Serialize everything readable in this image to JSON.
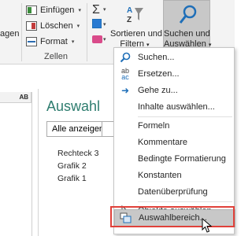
{
  "ribbon": {
    "left_fragment": "agen",
    "cells_group": {
      "insert_label": "Einfügen",
      "delete_label": "Löschen",
      "format_label": "Format",
      "group_label": "Zellen"
    },
    "editing_group": {
      "sort_filter_line1": "Sortieren und",
      "sort_filter_line2": "Filtern",
      "find_select_line1": "Suchen und",
      "find_select_line2": "Auswählen"
    }
  },
  "grid": {
    "column_header": "AB"
  },
  "selection_pane": {
    "title": "Auswahl",
    "show_all_label": "Alle anzeigen",
    "items": [
      {
        "label": "Rechteck 3"
      },
      {
        "label": "Grafik 2"
      },
      {
        "label": "Grafik 1"
      }
    ]
  },
  "menu": {
    "items": [
      {
        "label": "Suchen...",
        "icon": "magnifier-icon"
      },
      {
        "label": "Ersetzen...",
        "icon": "replace-icon"
      },
      {
        "label": "Gehe zu...",
        "icon": "arrow-right-icon"
      },
      {
        "label": "Inhalte auswählen...",
        "icon": ""
      },
      {
        "label": "Formeln",
        "icon": ""
      },
      {
        "label": "Kommentare",
        "icon": ""
      },
      {
        "label": "Bedingte Formatierung",
        "icon": ""
      },
      {
        "label": "Konstanten",
        "icon": ""
      },
      {
        "label": "Datenüberprüfung",
        "icon": ""
      },
      {
        "label": "Objekte auswählen",
        "icon": "pointer-arrow-icon"
      },
      {
        "label": "Auswahlbereich...",
        "icon": "selection-pane-icon"
      }
    ]
  },
  "colors": {
    "pane_title": "#2e7d6f",
    "highlight_box": "#e0413a",
    "accent_blue": "#2b7bd2"
  }
}
